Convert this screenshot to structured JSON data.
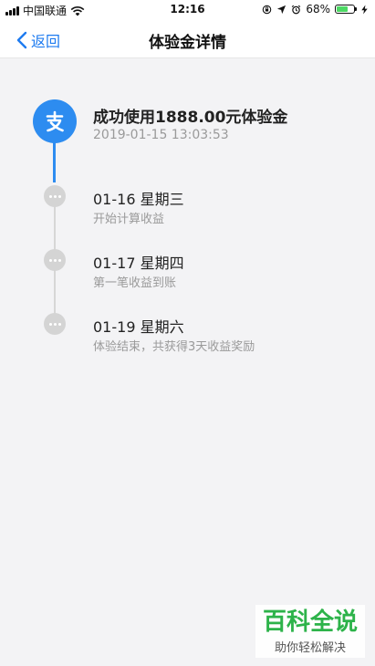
{
  "status_bar": {
    "carrier": "中国联通",
    "time": "12:16",
    "battery": "68%",
    "battery_level": 0.68
  },
  "nav": {
    "back_label": "返回",
    "title": "体验金详情"
  },
  "timeline": {
    "main_event": {
      "title": "成功使用1888.00元体验金",
      "time": "2019-01-15 13:03:53"
    },
    "events": [
      {
        "date": "01-16 星期三",
        "desc": "开始计算收益"
      },
      {
        "date": "01-17 星期四",
        "desc": "第一笔收益到账"
      },
      {
        "date": "01-19 星期六",
        "desc": "体验结束，共获得3天收益奖励"
      }
    ]
  },
  "watermark": {
    "title": "百科全说",
    "subtitle": "助你轻松解决"
  },
  "colors": {
    "accent": "#2d8cf0",
    "link": "#1e7bf0",
    "battery": "#4cd964",
    "watermark": "#2db34a"
  }
}
